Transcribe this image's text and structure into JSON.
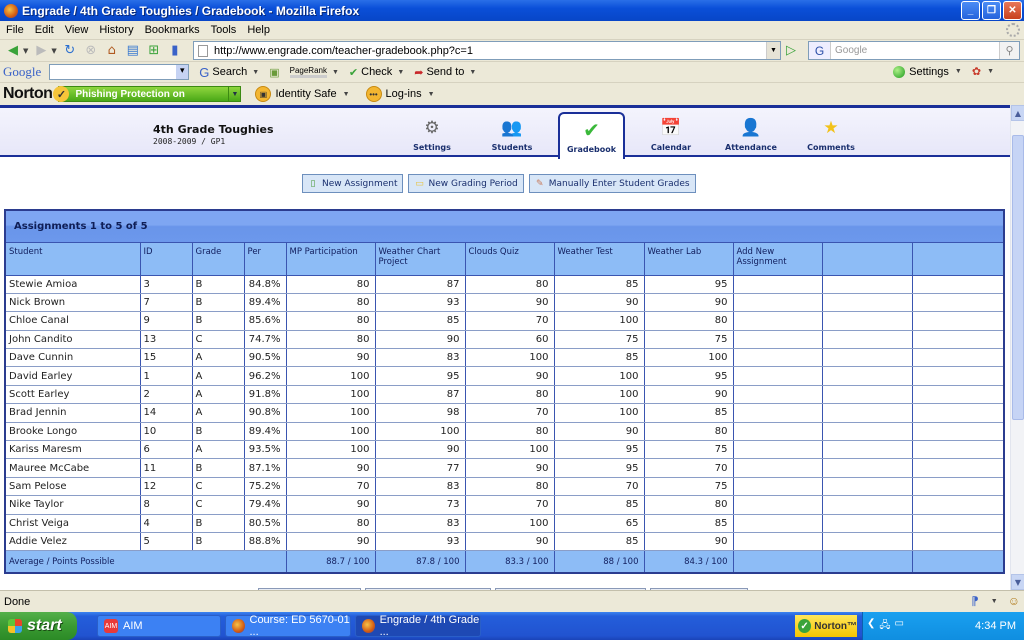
{
  "window": {
    "title": "Engrade / 4th Grade Toughies / Gradebook - Mozilla Firefox",
    "controls": [
      "minimize",
      "restore",
      "close"
    ]
  },
  "menubar": [
    "File",
    "Edit",
    "View",
    "History",
    "Bookmarks",
    "Tools",
    "Help"
  ],
  "navbar": {
    "url": "http://www.engrade.com/teacher-gradebook.php?c=1",
    "search_placeholder": "Google"
  },
  "google_toolbar": {
    "logo": "Google",
    "search_label": "Search",
    "pagerank_label": "PageRank",
    "check_label": "Check",
    "sendto_label": "Send to",
    "settings_label": "Settings"
  },
  "norton_toolbar": {
    "logo": "Norton",
    "phishing": "Phishing Protection on",
    "identity_safe": "Identity Safe",
    "logins": "Log-ins"
  },
  "page": {
    "class_title": "4th Grade Toughies",
    "class_subtitle": "2008-2009 / GP1",
    "tabs": [
      {
        "label": "Settings",
        "icon": "gear-icon",
        "active": false
      },
      {
        "label": "Students",
        "icon": "students-icon",
        "active": false
      },
      {
        "label": "Gradebook",
        "icon": "checkmark-icon",
        "active": true
      },
      {
        "label": "Calendar",
        "icon": "calendar-icon",
        "active": false
      },
      {
        "label": "Attendance",
        "icon": "attendance-icon",
        "active": false
      },
      {
        "label": "Comments",
        "icon": "star-icon",
        "active": false
      }
    ],
    "actions": {
      "new_assignment": "New Assignment",
      "new_grading_period": "New Grading Period",
      "manual_entry": "Manually Enter Student Grades"
    },
    "gradebook": {
      "title": "Assignments 1 to 5 of 5",
      "columns": [
        "Student",
        "ID",
        "Grade",
        "Per",
        "MP Participation",
        "Weather Chart Project",
        "Clouds Quiz",
        "Weather Test",
        "Weather Lab",
        "Add New Assignment",
        "",
        ""
      ],
      "rows": [
        [
          "Stewie Amioa",
          "3",
          "B",
          "84.8%",
          "80",
          "87",
          "80",
          "85",
          "95"
        ],
        [
          "Nick Brown",
          "7",
          "B",
          "89.4%",
          "80",
          "93",
          "90",
          "90",
          "90"
        ],
        [
          "Chloe Canal",
          "9",
          "B",
          "85.6%",
          "80",
          "85",
          "70",
          "100",
          "80"
        ],
        [
          "John Candito",
          "13",
          "C",
          "74.7%",
          "80",
          "90",
          "60",
          "75",
          "75"
        ],
        [
          "Dave Cunnin",
          "15",
          "A",
          "90.5%",
          "90",
          "83",
          "100",
          "85",
          "100"
        ],
        [
          "David Earley",
          "1",
          "A",
          "96.2%",
          "100",
          "95",
          "90",
          "100",
          "95"
        ],
        [
          "Scott Earley",
          "2",
          "A",
          "91.8%",
          "100",
          "87",
          "80",
          "100",
          "90"
        ],
        [
          "Brad Jennin",
          "14",
          "A",
          "90.8%",
          "100",
          "98",
          "70",
          "100",
          "85"
        ],
        [
          "Brooke Longo",
          "10",
          "B",
          "89.4%",
          "100",
          "100",
          "80",
          "90",
          "80"
        ],
        [
          "Kariss Maresm",
          "6",
          "A",
          "93.5%",
          "100",
          "90",
          "100",
          "95",
          "75"
        ],
        [
          "Mauree McCabe",
          "11",
          "B",
          "87.1%",
          "90",
          "77",
          "90",
          "95",
          "70"
        ],
        [
          "Sam Pelose",
          "12",
          "C",
          "75.2%",
          "70",
          "83",
          "80",
          "70",
          "75"
        ],
        [
          "Nike Taylor",
          "8",
          "C",
          "79.4%",
          "90",
          "73",
          "70",
          "85",
          "80"
        ],
        [
          "Christ Veiga",
          "4",
          "B",
          "80.5%",
          "80",
          "83",
          "100",
          "65",
          "85"
        ],
        [
          "Addie Velez",
          "5",
          "B",
          "88.8%",
          "90",
          "93",
          "90",
          "85",
          "90"
        ]
      ],
      "average_label": "Average / Points Possible",
      "averages": [
        "88.7 / 100",
        "87.8 / 100",
        "83.3 / 100",
        "88 / 100",
        "84.3 / 100"
      ]
    }
  },
  "statusbar": {
    "text": "Done"
  },
  "taskbar": {
    "start": "start",
    "tasks": [
      {
        "label": "AIM",
        "active": false
      },
      {
        "label": "Course: ED 5670-01 ...",
        "active": false
      },
      {
        "label": "Engrade / 4th Grade ...",
        "active": true
      }
    ],
    "norton": "Norton™",
    "clock": "4:34 PM"
  }
}
